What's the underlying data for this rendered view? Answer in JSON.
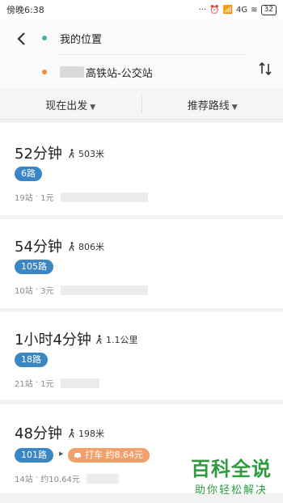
{
  "status_bar": {
    "time": "傍晚6:38",
    "network": "4G",
    "battery": "32"
  },
  "header": {
    "origin": "我的位置",
    "destination": "高铁站-公交站"
  },
  "filters": {
    "depart": "现在出发",
    "route_pref": "推荐路线"
  },
  "routes": [
    {
      "duration": "52分钟",
      "walk": "503米",
      "line": "6路",
      "stops": "19站",
      "fare": "1元"
    },
    {
      "duration": "54分钟",
      "walk": "806米",
      "line": "105路",
      "stops": "10站",
      "fare": "3元"
    },
    {
      "duration": "1小时4分钟",
      "walk": "1.1公里",
      "line": "18路",
      "stops": "21站",
      "fare": "1元"
    },
    {
      "duration": "48分钟",
      "walk": "198米",
      "line": "101路",
      "taxi": "打车 约8.64元",
      "stops": "14站",
      "fare": "约10.64元"
    }
  ],
  "watermark": {
    "title": "百科全说",
    "subtitle": "助你轻松解决"
  },
  "colors": {
    "accent_blue": "#3b86c4",
    "taxi_orange": "#f0a06a",
    "origin_dot": "#3bb5a0",
    "dest_dot": "#f08c3a",
    "watermark_green": "#2e9b3f"
  }
}
